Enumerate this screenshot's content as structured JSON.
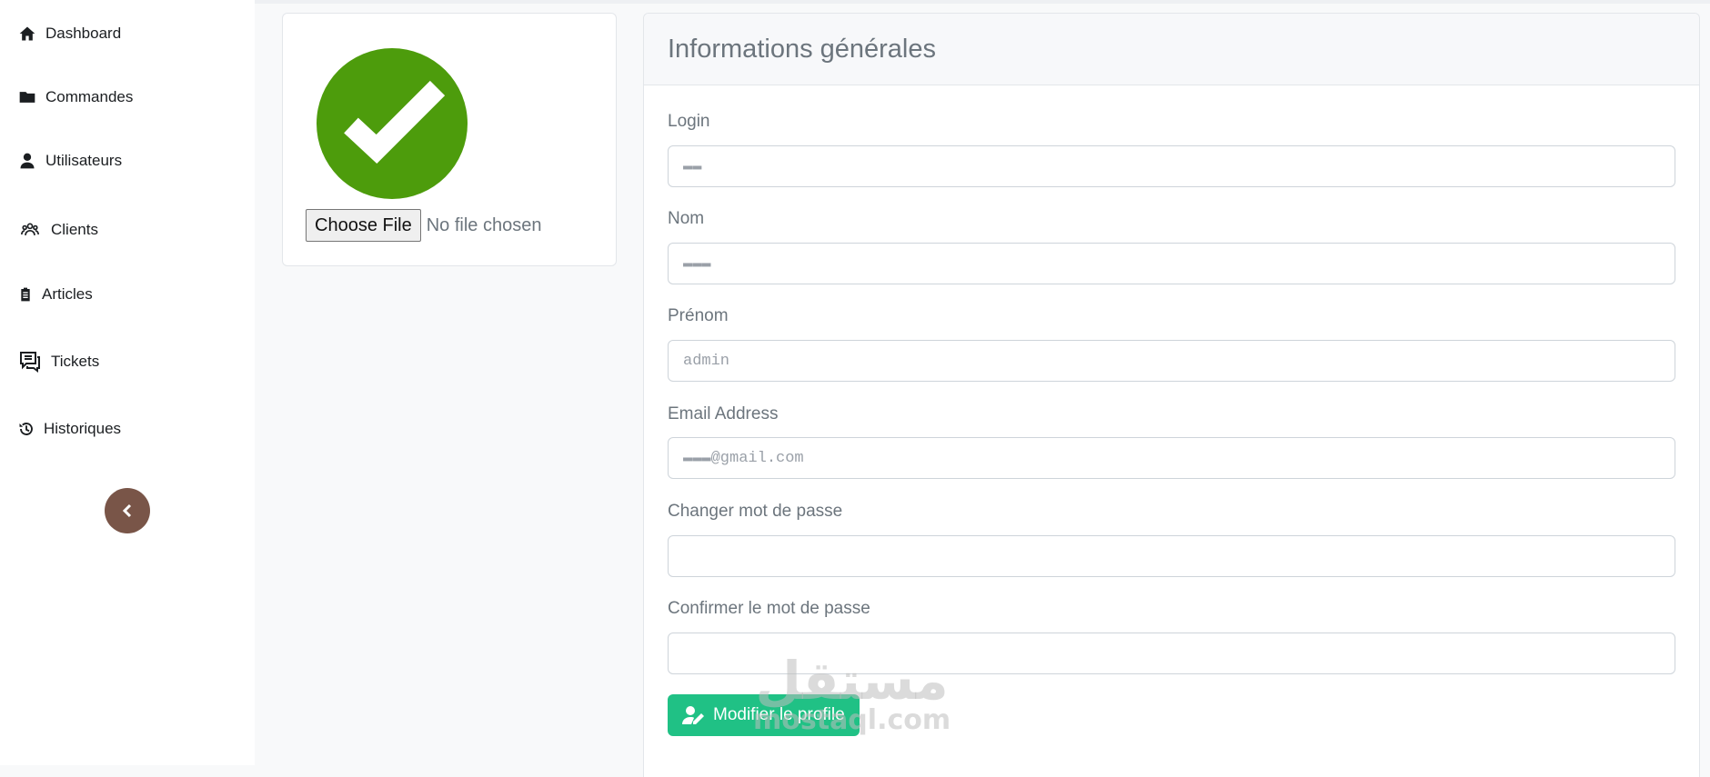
{
  "sidebar": {
    "items": [
      {
        "label": "Dashboard",
        "icon": "home-icon"
      },
      {
        "label": "Commandes",
        "icon": "folder-icon"
      },
      {
        "label": "Utilisateurs",
        "icon": "user-icon"
      },
      {
        "label": "Clients",
        "icon": "users-icon"
      },
      {
        "label": "Articles",
        "icon": "clipboard-icon"
      },
      {
        "label": "Tickets",
        "icon": "comments-icon"
      },
      {
        "label": "Historiques",
        "icon": "history-icon"
      }
    ],
    "collapse_icon": "chevron-left-icon",
    "collapse_color": "#795548"
  },
  "avatar": {
    "icon": "check-circle-icon",
    "color": "#4d9c0c",
    "file_button": "Choose File",
    "file_status": "No file chosen"
  },
  "form": {
    "title": "Informations générales",
    "fields": [
      {
        "label": "Login",
        "value": "▬▬"
      },
      {
        "label": "Nom",
        "value": "▬▬▬"
      },
      {
        "label": "Prénom",
        "value": "admin"
      },
      {
        "label": "Email Address",
        "value": "▬▬▬@gmail.com"
      },
      {
        "label": "Changer mot de passe",
        "value": ""
      },
      {
        "label": "Confirmer le mot de passe",
        "value": ""
      }
    ],
    "submit_label": "Modifier le profile",
    "submit_icon": "user-edit-icon",
    "submit_color": "#20c185"
  },
  "watermark": {
    "arabic": "مستقل",
    "latin": "mostaql.com"
  }
}
